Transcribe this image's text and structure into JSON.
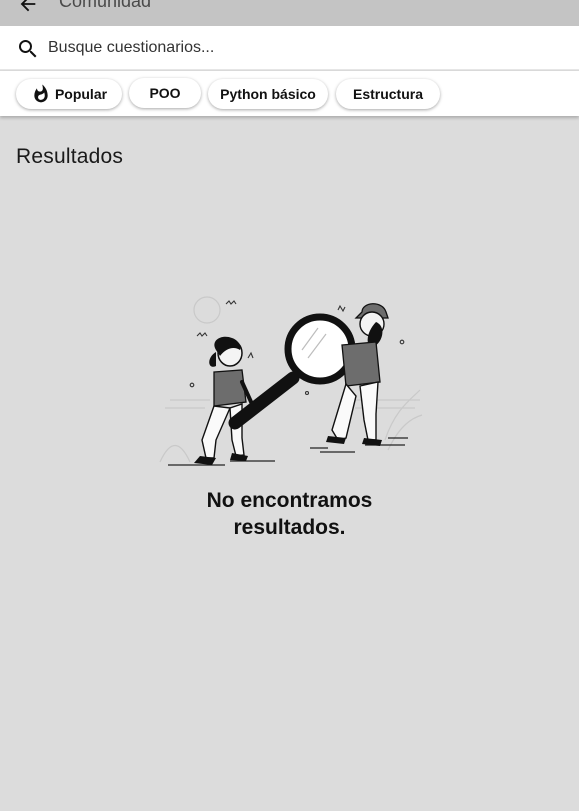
{
  "appbar": {
    "title": "Comunidad",
    "back_icon": "arrow-back-icon"
  },
  "search": {
    "placeholder": "Busque cuestionarios...",
    "value": "",
    "icon": "search-icon"
  },
  "chips": [
    {
      "label": "Popular",
      "icon": "fire-icon"
    },
    {
      "label": "POO"
    },
    {
      "label": "Python básico"
    },
    {
      "label": "Estructura"
    }
  ],
  "results": {
    "heading": "Resultados",
    "empty_line1": "No encontramos",
    "empty_line2": "resultados."
  },
  "colors": {
    "background": "#dcdcdc",
    "appbar": "#c4c4c4",
    "surface": "#ffffff"
  }
}
